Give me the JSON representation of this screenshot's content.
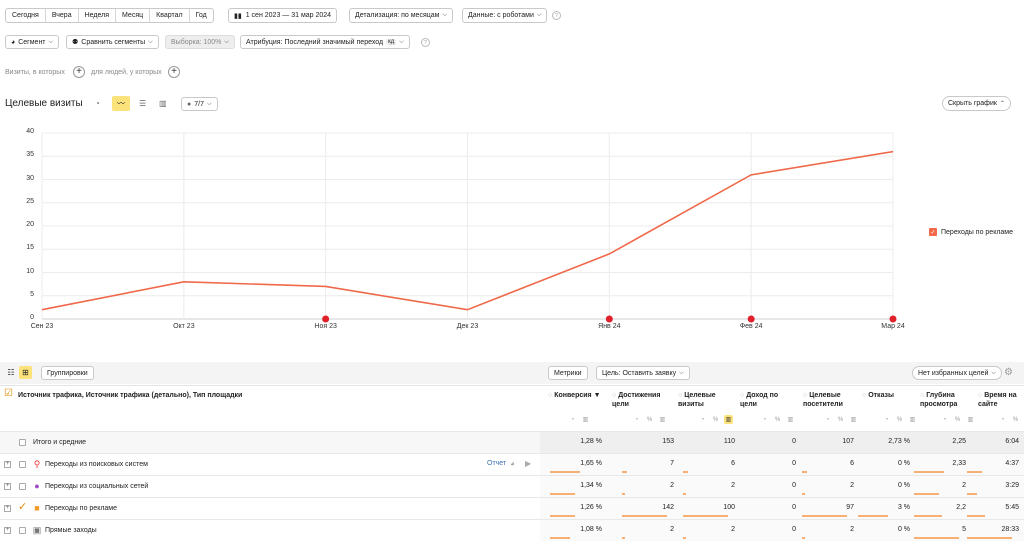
{
  "toolbar": {
    "periods": [
      "Сегодня",
      "Вчера",
      "Неделя",
      "Месяц",
      "Квартал",
      "Год"
    ],
    "date_range": "1 сен 2023 — 31 мар 2024",
    "detail": "Детализация: по месяцам",
    "data": "Данные: с роботами",
    "segment": "Сегмент",
    "compare": "Сравнить сегменты",
    "sample": "Выборка: 100%",
    "attribution": "Атрибуция: Последний значимый переход",
    "attribution_badge": "кд"
  },
  "filters": {
    "visits_label": "Визиты, в которых",
    "people_label": "для людей, у которых"
  },
  "chart_header": {
    "title": "Целевые визиты",
    "goals_count": "7/7",
    "hide_button": "Скрыть график"
  },
  "chart_data": {
    "type": "line",
    "categories": [
      "Сен 23",
      "Окт 23",
      "Ноя 23",
      "Дек 23",
      "Янв 24",
      "Фев 24",
      "Мар 24"
    ],
    "series": [
      {
        "name": "Переходы по рекламе",
        "values": [
          2,
          8,
          7,
          2,
          14,
          31,
          36
        ],
        "color": "#f0694a"
      }
    ],
    "ylim": [
      0,
      40
    ],
    "yticks": [
      "0",
      "5",
      "10",
      "15",
      "20",
      "25",
      "30",
      "35",
      "40"
    ],
    "grid": true,
    "legend": "right",
    "event_markers": [
      {
        "category_index": 2
      },
      {
        "category_index": 4
      },
      {
        "category_index": 5
      },
      {
        "category_index": 6
      }
    ]
  },
  "legend": {
    "label": "Переходы по рекламе",
    "color": "#f0694a"
  },
  "table_toolbar": {
    "groupings": "Группировки",
    "metrics": "Метрики",
    "goal": "Цель: Оставить заявку",
    "no_fav": "Нет избранных целей"
  },
  "table": {
    "dimension_header": "Источник трафика, Источник трафика (детально), Тип площадки",
    "columns": [
      {
        "label": "Конверсия",
        "sort": "▼"
      },
      {
        "label": "Достижения цели"
      },
      {
        "label": "Целевые визиты"
      },
      {
        "label": "Доход по цели"
      },
      {
        "label": "Целевые посетители"
      },
      {
        "label": "Отказы"
      },
      {
        "label": "Глубина просмотра"
      },
      {
        "label": "Время на сайте"
      }
    ],
    "totals": {
      "label": "Итого и средние",
      "values": [
        "1,28 %",
        "153",
        "110",
        "0",
        "107",
        "2,73 %",
        "2,25",
        "6:04"
      ]
    },
    "rows": [
      {
        "label": "Переходы из поисковых систем",
        "icon": "search-icon",
        "report": "Отчет",
        "values": [
          "1,65 %",
          "7",
          "6",
          "0",
          "6",
          "0 %",
          "2,33",
          "4:37"
        ],
        "bars": [
          0.6,
          0.1,
          0.1,
          0,
          0.1,
          0,
          0.6,
          0.3
        ]
      },
      {
        "label": "Переходы из социальных сетей",
        "icon": "person-icon",
        "values": [
          "1,34 %",
          "2",
          "2",
          "0",
          "2",
          "0 %",
          "2",
          "3:29"
        ],
        "bars": [
          0.5,
          0.05,
          0.05,
          0,
          0.05,
          0,
          0.5,
          0.2
        ]
      },
      {
        "label": "Переходы по рекламе",
        "icon": "ad-icon",
        "checked": true,
        "values": [
          "1,26 %",
          "142",
          "100",
          "0",
          "97",
          "3 %",
          "2,2",
          "5:45"
        ],
        "bars": [
          0.5,
          0.9,
          0.9,
          0,
          0.9,
          0.6,
          0.55,
          0.35
        ]
      },
      {
        "label": "Прямые заходы",
        "icon": "direct-icon",
        "values": [
          "1,08 %",
          "2",
          "2",
          "0",
          "2",
          "0 %",
          "5",
          "28:33"
        ],
        "bars": [
          0.4,
          0.05,
          0.05,
          0,
          0.05,
          0,
          0.9,
          0.9
        ]
      }
    ]
  }
}
